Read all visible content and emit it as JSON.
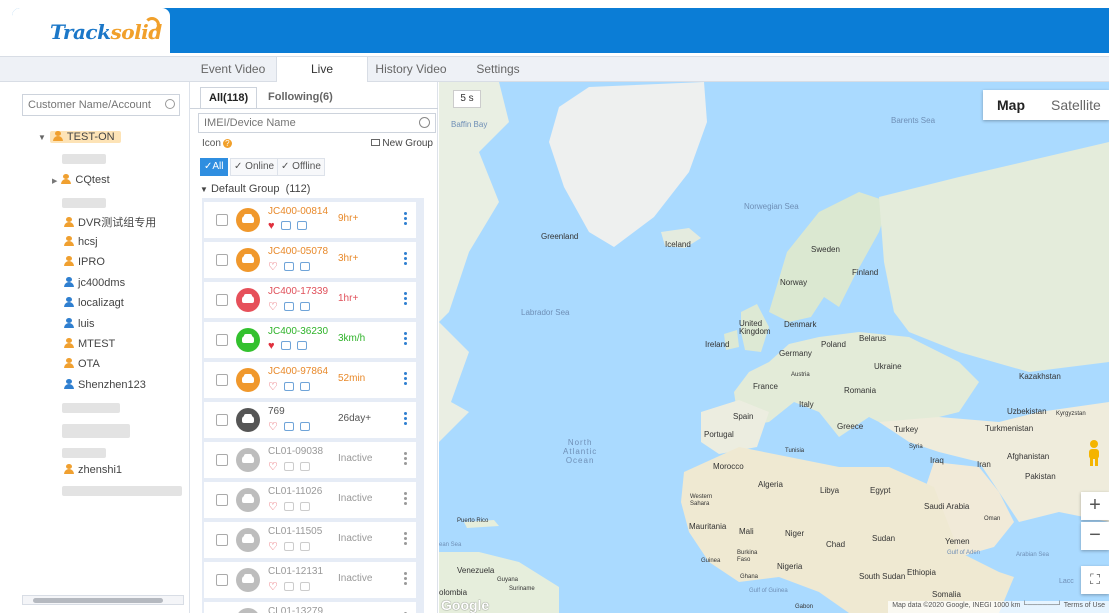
{
  "header": {
    "logo_main": "Track",
    "logo_accent": "solid"
  },
  "tabs": [
    "Event Video",
    "Live",
    "History Video",
    "Settings"
  ],
  "sidebar": {
    "search_placeholder": "Customer Name/Account",
    "root": "TEST-ON",
    "items": [
      {
        "label": "CQtest",
        "color": "orange"
      },
      {
        "label": "DVR测试组专用",
        "color": "orange"
      },
      {
        "label": "hcsj",
        "color": "orange"
      },
      {
        "label": "IPRO",
        "color": "orange"
      },
      {
        "label": "jc400dms",
        "color": "blue"
      },
      {
        "label": "localizagt",
        "color": "blue"
      },
      {
        "label": "luis",
        "color": "blue"
      },
      {
        "label": "MTEST",
        "color": "orange"
      },
      {
        "label": "OTA",
        "color": "orange"
      },
      {
        "label": "Shenzhen123",
        "color": "blue"
      },
      {
        "label": "zhenshi1",
        "color": "orange"
      }
    ]
  },
  "devices_panel": {
    "tab_all": "All(118)",
    "tab_following": "Following(6)",
    "search_placeholder": "IMEI/Device Name",
    "icon_label": "Icon",
    "new_group": "New Group",
    "filter_all": "All",
    "filter_online": "Online",
    "filter_offline": "Offline",
    "group_name": "Default Group",
    "group_count": "(112)",
    "devices": [
      {
        "name": "JC400-00814",
        "status": "9hr+",
        "color": "#f0982c",
        "name_color": "#e8892a",
        "status_color": "#e8892a",
        "heart": "filled"
      },
      {
        "name": "JC400-05078",
        "status": "3hr+",
        "color": "#f0982c",
        "name_color": "#e8892a",
        "status_color": "#e8892a",
        "heart": "outline"
      },
      {
        "name": "JC400-17339",
        "status": "1hr+",
        "color": "#e6505a",
        "name_color": "#e0505a",
        "status_color": "#e0505a",
        "heart": "outline"
      },
      {
        "name": "JC400-36230",
        "status": "3km/h",
        "color": "#33c12e",
        "name_color": "#2fb32a",
        "status_color": "#2fb32a",
        "heart": "filled"
      },
      {
        "name": "JC400-97864",
        "status": "52min",
        "color": "#f0982c",
        "name_color": "#e8892a",
        "status_color": "#e8892a",
        "heart": "outline"
      },
      {
        "name": "769",
        "status": "26day+",
        "color": "#555555",
        "name_color": "#555555",
        "status_color": "#555555",
        "heart": "outline"
      },
      {
        "name": "CL01-09038",
        "status": "Inactive",
        "color": "#bdbdbd",
        "name_color": "#999999",
        "status_color": "#999999",
        "heart": "outline"
      },
      {
        "name": "CL01-11026",
        "status": "Inactive",
        "color": "#bdbdbd",
        "name_color": "#999999",
        "status_color": "#999999",
        "heart": "outline"
      },
      {
        "name": "CL01-11505",
        "status": "Inactive",
        "color": "#bdbdbd",
        "name_color": "#999999",
        "status_color": "#999999",
        "heart": "outline"
      },
      {
        "name": "CL01-12131",
        "status": "Inactive",
        "color": "#bdbdbd",
        "name_color": "#999999",
        "status_color": "#999999",
        "heart": "outline"
      },
      {
        "name": "CL01-13279",
        "status": "",
        "color": "#bdbdbd",
        "name_color": "#999999",
        "status_color": "#999999",
        "heart": "outline"
      }
    ]
  },
  "map": {
    "refresh": "5 s",
    "type_map": "Map",
    "type_satellite": "Satellite",
    "zoom_in": "+",
    "zoom_out": "−",
    "fullscreen": "⛶",
    "attribution": "Map data ©2020 Google, INEGI   1000 km └──────┘   Terms of Use",
    "google": "Google",
    "labels": {
      "baffin": "Baffin Bay",
      "barents": "Barents Sea",
      "norwegian": "Norwegian Sea",
      "greenland": "Greenland",
      "iceland": "Iceland",
      "sweden": "Sweden",
      "finland": "Finland",
      "norway": "Norway",
      "labrador": "Labrador Sea",
      "uk": "United\nKingdom",
      "denmark": "Denmark",
      "belarus": "Belarus",
      "ireland": "Ireland",
      "poland": "Poland",
      "germany": "Germany",
      "ukraine": "Ukraine",
      "kazakhstan": "Kazakhstan",
      "austria": "Austria",
      "france": "France",
      "romania": "Romania",
      "italy": "Italy",
      "uzbekistan": "Uzbekistan",
      "kyrgyzstan": "Kyrgyzstan",
      "spain": "Spain",
      "greece": "Greece",
      "turkey": "Turkey",
      "turkmenistan": "Turkmenistan",
      "portugal": "Portugal",
      "north_atlantic": "North\nAtlantic\nOcean",
      "tunisia": "Tunisia",
      "syria": "Syria",
      "iraq": "Iraq",
      "iran": "Iran",
      "afghanistan": "Afghanistan",
      "morocco": "Morocco",
      "pakistan": "Pakistan",
      "algeria": "Algeria",
      "libya": "Libya",
      "egypt": "Egypt",
      "western_sahara": "Western\nSahara",
      "saudi": "Saudi Arabia",
      "oman": "Oman",
      "mauritania": "Mauritania",
      "mali": "Mali",
      "niger": "Niger",
      "chad": "Chad",
      "sudan": "Sudan",
      "yemen": "Yemen",
      "puerto_rico": "Puerto Rico",
      "gulf_aden": "Gulf of Aden",
      "arabian_sea": "Arabian Sea",
      "guinea": "Guinea",
      "burkina": "Burkina\nFaso",
      "nigeria": "Nigeria",
      "venezuela": "Venezuela",
      "guyana": "Guyana",
      "suriname": "Suriname",
      "ghana": "Ghana",
      "south_sudan": "South Sudan",
      "ethiopia": "Ethiopia",
      "somalia": "Somalia",
      "gulf_guinea": "Gulf of Guinea",
      "colombia": "olombia",
      "gabon": "Gabon",
      "ean_sea": "ean Sea",
      "laccadive": "Lacc"
    }
  }
}
